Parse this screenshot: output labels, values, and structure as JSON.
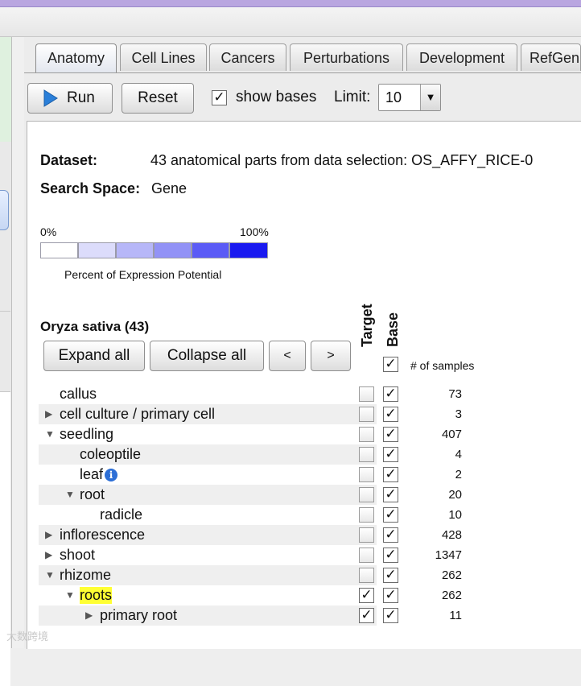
{
  "tabs": [
    "Anatomy",
    "Cell Lines",
    "Cancers",
    "Perturbations",
    "Development",
    "RefGen"
  ],
  "toolbar": {
    "run_label": "Run",
    "reset_label": "Reset",
    "show_bases_label": "show bases",
    "show_bases_checked": true,
    "limit_label": "Limit:",
    "limit_value": "10"
  },
  "dataset": {
    "label": "Dataset:",
    "value": "43 anatomical parts from data selection: OS_AFFY_RICE-0",
    "search_label": "Search Space:",
    "search_value": "Gene"
  },
  "legend": {
    "min": "0%",
    "max": "100%",
    "caption": "Percent of Expression Potential",
    "colors": [
      "#ffffff",
      "#dcdcfb",
      "#b7b7f8",
      "#9292f6",
      "#5b5bf6",
      "#1a1af0"
    ]
  },
  "tree": {
    "title": "Oryza sativa (43)",
    "expand_all": "Expand all",
    "collapse_all": "Collapse all",
    "prev": "<",
    "next": ">",
    "target_header": "Target",
    "base_header": "Base",
    "samples_header": "# of samples",
    "rows": [
      {
        "label": "callus",
        "level": 0,
        "expander": "",
        "count": "73",
        "target": false,
        "base": true,
        "info": false,
        "highlight": false
      },
      {
        "label": "cell culture / primary cell",
        "level": 0,
        "expander": "collapsed",
        "count": "3",
        "target": false,
        "base": true,
        "info": false,
        "highlight": false
      },
      {
        "label": "seedling",
        "level": 0,
        "expander": "expanded",
        "count": "407",
        "target": false,
        "base": true,
        "info": false,
        "highlight": false
      },
      {
        "label": "coleoptile",
        "level": 1,
        "expander": "",
        "count": "4",
        "target": false,
        "base": true,
        "info": false,
        "highlight": false
      },
      {
        "label": "leaf",
        "level": 1,
        "expander": "",
        "count": "2",
        "target": false,
        "base": true,
        "info": true,
        "highlight": false
      },
      {
        "label": "root",
        "level": 1,
        "expander": "expanded",
        "count": "20",
        "target": false,
        "base": true,
        "info": false,
        "highlight": false
      },
      {
        "label": "radicle",
        "level": 2,
        "expander": "",
        "count": "10",
        "target": false,
        "base": true,
        "info": false,
        "highlight": false
      },
      {
        "label": "inflorescence",
        "level": 0,
        "expander": "collapsed",
        "count": "428",
        "target": false,
        "base": true,
        "info": false,
        "highlight": false
      },
      {
        "label": "shoot",
        "level": 0,
        "expander": "collapsed",
        "count": "1347",
        "target": false,
        "base": true,
        "info": false,
        "highlight": false
      },
      {
        "label": "rhizome",
        "level": 0,
        "expander": "expanded",
        "count": "262",
        "target": false,
        "base": true,
        "info": false,
        "highlight": false
      },
      {
        "label": "roots",
        "level": 1,
        "expander": "expanded",
        "count": "262",
        "target": true,
        "base": true,
        "info": false,
        "highlight": true
      },
      {
        "label": "primary root",
        "level": 2,
        "expander": "collapsed",
        "count": "11",
        "target": true,
        "base": true,
        "info": false,
        "highlight": false
      }
    ]
  },
  "watermark": "大数跨境"
}
